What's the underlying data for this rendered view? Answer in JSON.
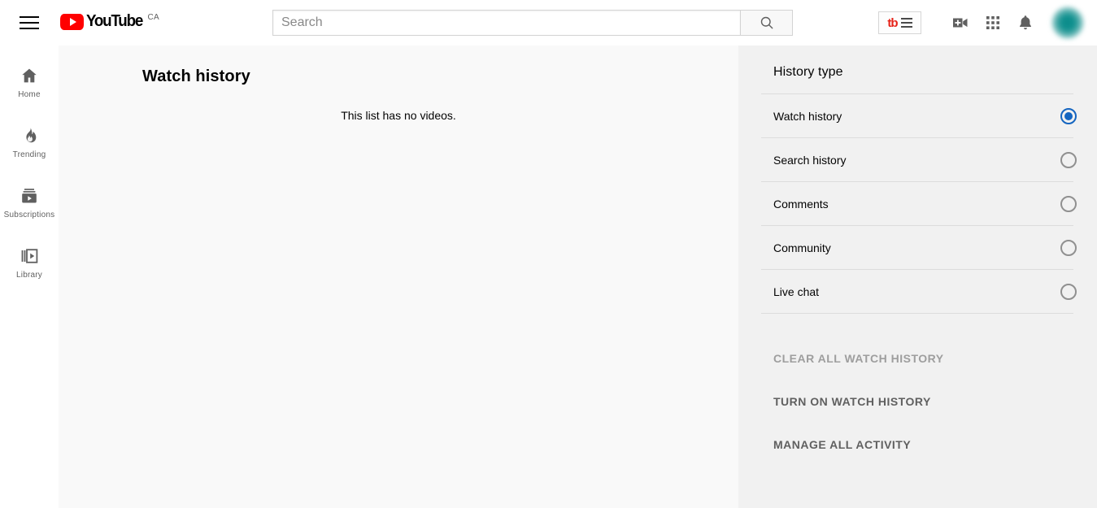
{
  "header": {
    "menu_icon": "hamburger-menu-icon",
    "logo_text": "YouTube",
    "logo_country": "CA",
    "search": {
      "placeholder": "Search",
      "value": "",
      "button_icon": "search-icon"
    },
    "tubebuddy": {
      "logo_text": "tb",
      "menu_icon": "hamburger-lines-icon"
    },
    "icons": [
      {
        "name": "create-video-icon"
      },
      {
        "name": "apps-grid-icon"
      },
      {
        "name": "notifications-bell-icon"
      }
    ],
    "avatar": "account-avatar"
  },
  "sidebar": {
    "items": [
      {
        "label": "Home",
        "icon": "home-icon"
      },
      {
        "label": "Trending",
        "icon": "trending-flame-icon"
      },
      {
        "label": "Subscriptions",
        "icon": "subscriptions-icon"
      },
      {
        "label": "Library",
        "icon": "library-icon"
      }
    ]
  },
  "main": {
    "title": "Watch history",
    "empty_message": "This list has no videos."
  },
  "right_panel": {
    "title": "History type",
    "options": [
      {
        "label": "Watch history",
        "selected": true
      },
      {
        "label": "Search history",
        "selected": false
      },
      {
        "label": "Comments",
        "selected": false
      },
      {
        "label": "Community",
        "selected": false
      },
      {
        "label": "Live chat",
        "selected": false
      }
    ],
    "actions": [
      {
        "label": "CLEAR ALL WATCH HISTORY",
        "disabled": true
      },
      {
        "label": "TURN ON WATCH HISTORY",
        "disabled": false
      },
      {
        "label": "MANAGE ALL ACTIVITY",
        "disabled": false
      }
    ]
  },
  "colors": {
    "brand_red": "#ff0000",
    "accent_blue": "#1565c0",
    "tubebuddy_red": "#e62117",
    "panel_bg": "#f1f1f1",
    "main_bg": "#f9f9f9"
  }
}
